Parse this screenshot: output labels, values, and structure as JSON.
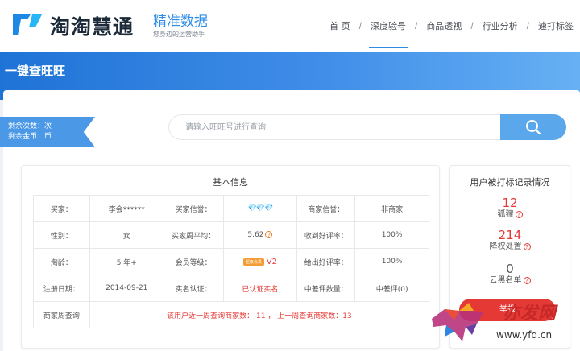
{
  "brand": {
    "logo_text": "淘淘慧通",
    "product_title": "精准数据",
    "product_subtitle": "您身边的运营助手"
  },
  "nav": {
    "items": [
      {
        "label": "首 页"
      },
      {
        "label": "深度验号",
        "active": true
      },
      {
        "label": "商品透视"
      },
      {
        "label": "行业分析"
      },
      {
        "label": "速打标签"
      }
    ],
    "separator": "/"
  },
  "banner": {
    "title": "一键查旺旺"
  },
  "ribbon": {
    "remaining_count": "剩余次数：次",
    "remaining_coins": "剩余金币：币"
  },
  "search": {
    "placeholder": "请输入旺旺号进行查询"
  },
  "basic_info": {
    "title": "基本信息",
    "rows": [
      [
        "买家：",
        "李会******",
        "买家信誉：",
        "💎💎💎",
        "商家信誉：",
        "非商家"
      ],
      [
        "性别：",
        "女",
        "买家周平均：",
        "5.62",
        "收到好评率：",
        "100%"
      ],
      [
        "淘龄：",
        "5 年+",
        "会员等级：",
        "V2",
        "给出好评率：",
        "100%"
      ],
      [
        "注册日期：",
        "2014-09-21",
        "实名认证：",
        "已认证实名",
        "中差评数量：",
        "中差评(0)"
      ]
    ],
    "query_label": "商家周查询",
    "query_text": "该用户近一周查询商家数：  11 ，  上一周查询商家数：13",
    "vip_badge": "超级会员"
  },
  "mark_record": {
    "title": "用户被打标记录情况",
    "stats": [
      {
        "value": "12",
        "label": "狐狸",
        "color": "#e53935"
      },
      {
        "value": "214",
        "label": "降权处置",
        "color": "#e53935"
      },
      {
        "value": "0",
        "label": "云黑名单",
        "color": "#555555"
      }
    ],
    "report_label": "举报"
  },
  "watermark": {
    "text_top": "亦发网",
    "text_bottom": "www.yfd.cn"
  },
  "colors": {
    "accent": "#2f8ce6",
    "banner_start": "#1f73d6",
    "banner_end": "#67b0f4",
    "danger": "#e53935"
  }
}
